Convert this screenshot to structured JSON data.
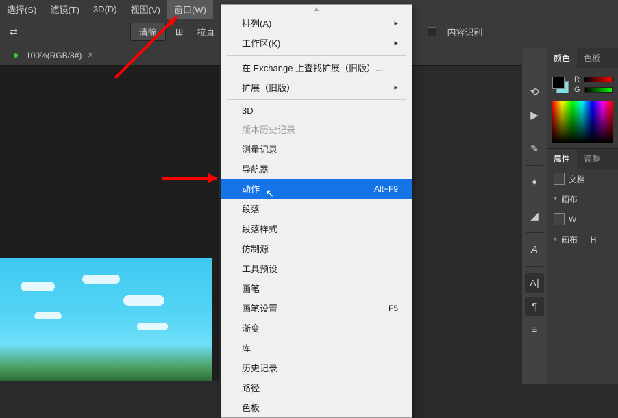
{
  "menubar": {
    "items": [
      {
        "label": "选择(S)"
      },
      {
        "label": "滤镜(T)"
      },
      {
        "label": "3D(D)"
      },
      {
        "label": "视图(V)"
      },
      {
        "label": "窗口(W)"
      }
    ]
  },
  "toolbar": {
    "clear_label": "清除",
    "drag_label": "拉直",
    "content_aware_label": "内容识别"
  },
  "document": {
    "tab_label": "100%(RGB/8#)"
  },
  "dropdown": {
    "items": [
      {
        "label": "排列(A)",
        "arrow": true
      },
      {
        "label": "工作区(K)",
        "arrow": true
      },
      {
        "sep": true
      },
      {
        "label": "在 Exchange 上查找扩展（旧版）..."
      },
      {
        "label": "扩展（旧版）",
        "arrow": true
      },
      {
        "sep": true
      },
      {
        "label": "3D"
      },
      {
        "label": "版本历史记录",
        "disabled": true
      },
      {
        "label": "测量记录"
      },
      {
        "label": "导航器"
      },
      {
        "label": "动作",
        "shortcut": "Alt+F9",
        "selected": true
      },
      {
        "label": "段落"
      },
      {
        "label": "段落样式"
      },
      {
        "label": "仿制源"
      },
      {
        "label": "工具预设"
      },
      {
        "label": "画笔"
      },
      {
        "label": "画笔设置",
        "shortcut": "F5"
      },
      {
        "label": "渐变"
      },
      {
        "label": "库"
      },
      {
        "label": "历史记录"
      },
      {
        "label": "路径"
      },
      {
        "label": "色板"
      }
    ]
  },
  "panels": {
    "color_tab": "颜色",
    "swatches_tab": "色板",
    "r_label": "R",
    "g_label": "G",
    "properties_tab": "属性",
    "adjust_tab": "调整",
    "doc_label": "文档",
    "canvas_label": "画布",
    "w_label": "W",
    "h_label": "H"
  }
}
